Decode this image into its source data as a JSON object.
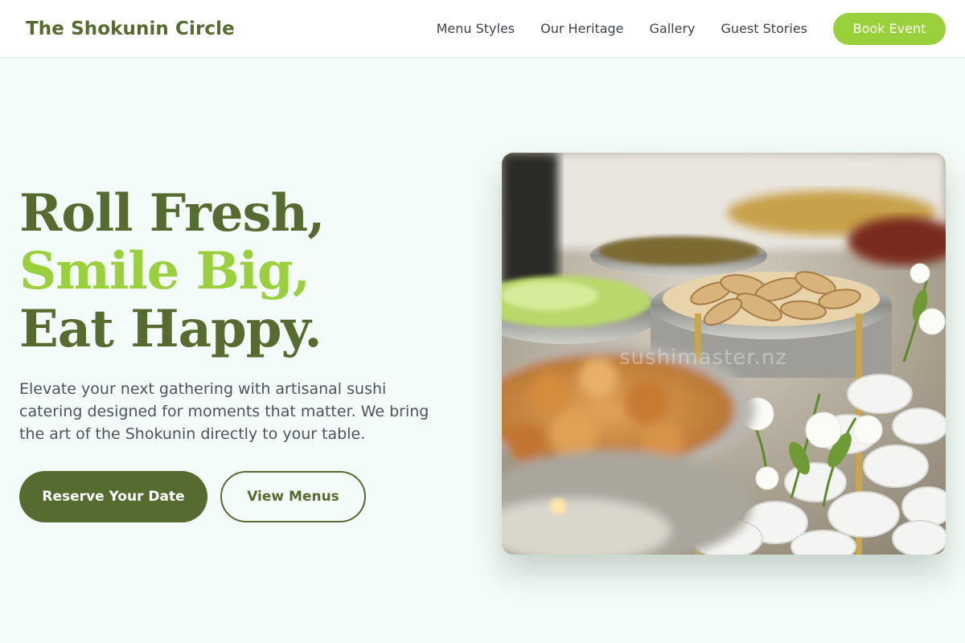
{
  "header": {
    "brand": "The Shokunin Circle",
    "nav": [
      "Menu Styles",
      "Our Heritage",
      "Gallery",
      "Guest Stories"
    ],
    "cta": "Book Event"
  },
  "hero": {
    "title_line1": "Roll Fresh,",
    "title_line2": "Smile Big,",
    "title_line3": "Eat Happy.",
    "subtitle": "Elevate your next gathering with artisanal sushi catering designed for moments that matter. We bring the art of the Shokunin directly to your table.",
    "primary_button": "Reserve Your Date",
    "secondary_button": "View Menus"
  },
  "photo": {
    "watermark": "sushimaster.nz"
  },
  "colors": {
    "brand_dark": "#556b2f",
    "brand_accent": "#9ad03c",
    "background": "#f3fcf8"
  }
}
